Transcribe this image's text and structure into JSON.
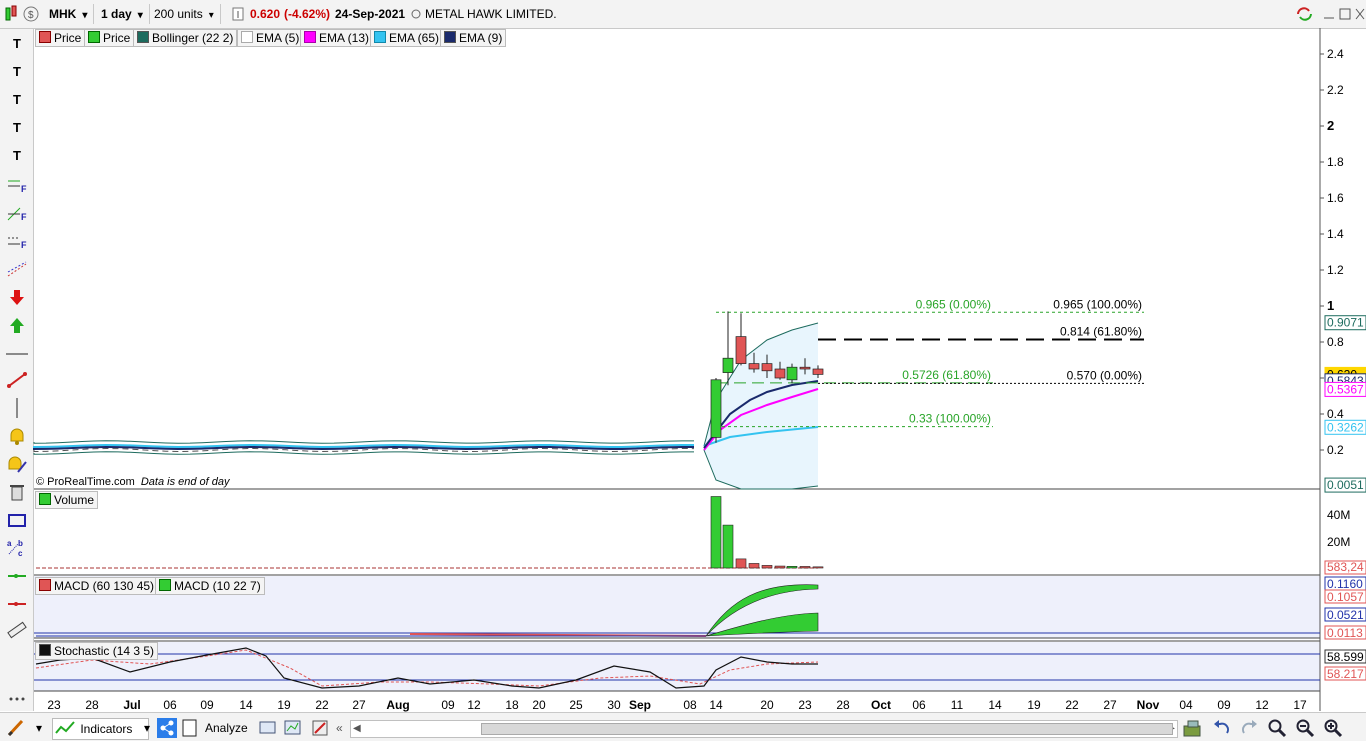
{
  "toolbar": {
    "symbol": "MHK",
    "interval": "1 day",
    "units": "200 units",
    "price": "0.620",
    "change": "(-4.62%)",
    "date": "24-Sep-2021",
    "name": "METAL HAWK LIMITED."
  },
  "legend": {
    "price1": "Price",
    "price2": "Price",
    "bollinger": "Bollinger (22 2)",
    "ema5": "EMA (5)",
    "ema13": "EMA (13)",
    "ema65": "EMA (65)",
    "ema9": "EMA (9)",
    "volume": "Volume",
    "macd1": "MACD (60 130 45)",
    "macd2": "MACD (10 22 7)",
    "stochastic": "Stochastic (14 3 5)"
  },
  "watermark": {
    "source": "© ProRealTime.com",
    "note": "Data is end of day"
  },
  "colors": {
    "up": "#33cc33",
    "down": "#e05555",
    "ema5": "#ffffff",
    "ema13": "#ff00ff",
    "ema65": "#33c3f0",
    "ema9": "#1a2a6c",
    "bollinger": "#1d6b5e",
    "fib_green": "#28a428",
    "panel_bg": "#eef0fb"
  },
  "icons": [
    "text-tool-icon",
    "fib-tool-icon",
    "arrow-down-icon",
    "arrow-up-icon",
    "line-icon",
    "trend-line-icon",
    "alert-icon",
    "trash-icon",
    "rectangle-icon",
    "measure-icon",
    "pencil-icon",
    "share-icon",
    "undo-icon",
    "redo-icon",
    "zoom-in-icon",
    "zoom-out-icon"
  ],
  "bottom": {
    "indicators": "Indicators",
    "analyze": "Analyze"
  },
  "chart_data": {
    "type": "candlestick",
    "price_axis": {
      "ticks": [
        "2.4",
        "2.2",
        "2",
        "1.8",
        "1.6",
        "1.4",
        "1.2",
        "1",
        "0.8",
        "0.6",
        "0.4",
        "0.2"
      ],
      "ylim": [
        0,
        2.5
      ]
    },
    "price_labels": [
      {
        "text": "0.9071",
        "value": 0.9071,
        "color": "#1d6b5e"
      },
      {
        "text": "0.620",
        "value": 0.62,
        "color": "#ffd700"
      },
      {
        "text": "0.5843",
        "value": 0.5843,
        "color": "#1a2a6c"
      },
      {
        "text": "0.5367",
        "value": 0.5367,
        "color": "#ff00ff"
      },
      {
        "text": "0.3262",
        "value": 0.3262,
        "color": "#33c3f0"
      },
      {
        "text": "0.0051",
        "value": 0.0051,
        "color": "#1d6b5e"
      }
    ],
    "x_ticks": [
      "23",
      "28",
      "Jul",
      "06",
      "09",
      "14",
      "19",
      "22",
      "27",
      "Aug",
      "09",
      "12",
      "18",
      "20",
      "25",
      "30",
      "Sep",
      "08",
      "14",
      "20",
      "23",
      "28",
      "Oct",
      "06",
      "11",
      "14",
      "19",
      "22",
      "27",
      "Nov",
      "04",
      "09",
      "12",
      "17"
    ],
    "candles": [
      {
        "date": "13-Sep",
        "open": 0.27,
        "high": 0.6,
        "low": 0.24,
        "close": 0.59
      },
      {
        "date": "14-Sep",
        "open": 0.63,
        "high": 0.97,
        "low": 0.56,
        "close": 0.71
      },
      {
        "date": "15-Sep",
        "open": 0.83,
        "high": 0.96,
        "low": 0.67,
        "close": 0.68
      },
      {
        "date": "16-Sep",
        "open": 0.68,
        "high": 0.74,
        "low": 0.63,
        "close": 0.65
      },
      {
        "date": "17-Sep",
        "open": 0.68,
        "high": 0.73,
        "low": 0.6,
        "close": 0.64
      },
      {
        "date": "20-Sep",
        "open": 0.65,
        "high": 0.69,
        "low": 0.59,
        "close": 0.6
      },
      {
        "date": "21-Sep",
        "open": 0.59,
        "high": 0.68,
        "low": 0.57,
        "close": 0.66
      },
      {
        "date": "23-Sep",
        "open": 0.66,
        "high": 0.71,
        "low": 0.62,
        "close": 0.65
      },
      {
        "date": "24-Sep",
        "open": 0.65,
        "high": 0.67,
        "low": 0.6,
        "close": 0.62
      }
    ],
    "flat_price_before": 0.2,
    "fibonacci": [
      {
        "label": "0.965 (0.00%)",
        "value": 0.965,
        "color": "#28a428"
      },
      {
        "label": "0.965 (100.00%)",
        "value": 0.965,
        "color": "#000000"
      },
      {
        "label": "0.814 (61.80%)",
        "value": 0.814,
        "color": "#000000"
      },
      {
        "label": "0.5726 (61.80%)",
        "value": 0.5726,
        "color": "#28a428"
      },
      {
        "label": "0.570 (0.00%)",
        "value": 0.57,
        "color": "#000000"
      },
      {
        "label": "0.33 (100.00%)",
        "value": 0.33,
        "color": "#28a428"
      }
    ],
    "volume": {
      "ticks": [
        "40M",
        "20M"
      ],
      "last_label": "583,24",
      "values": [
        55000000,
        33000000,
        7000000,
        3500000,
        2000000,
        1500000,
        1300000,
        1200000,
        900000
      ]
    },
    "macd": {
      "labels": [
        "0.1160",
        "0.1057",
        "0.0521",
        "0.0113"
      ]
    },
    "stochastic": {
      "labels": [
        "58.599",
        "58.217"
      ]
    }
  }
}
